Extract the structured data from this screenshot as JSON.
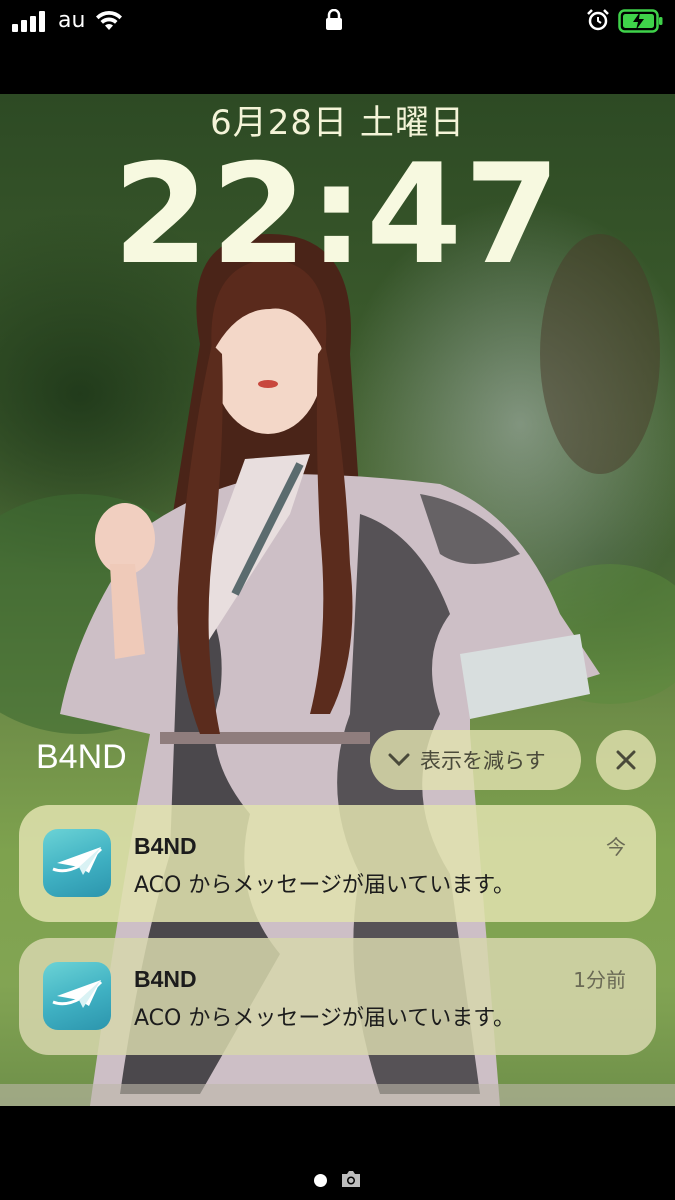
{
  "status_bar": {
    "carrier": "au",
    "icons": [
      "signal-bars-icon",
      "wifi-icon",
      "lock-icon",
      "alarm-icon",
      "battery-charging-icon"
    ],
    "battery_color": "#3fd24a"
  },
  "lock_screen": {
    "date": "6月28日 土曜日",
    "time": "22:47"
  },
  "notification_group": {
    "title": "B4ND",
    "show_less_label": "表示を減らす",
    "clear_icon": "close-icon"
  },
  "notifications": [
    {
      "app": "B4ND",
      "message": "ACO からメッセージが届いています。",
      "time": "今",
      "icon": "paper-plane-icon"
    },
    {
      "app": "B4ND",
      "message": "ACO からメッセージが届いています。",
      "time": "1分前",
      "icon": "paper-plane-icon"
    }
  ],
  "bottom": {
    "icons": [
      "page-dot",
      "camera-icon"
    ]
  },
  "colors": {
    "notification_bg": "#e1e2af",
    "app_icon": "#3fb0c2"
  }
}
